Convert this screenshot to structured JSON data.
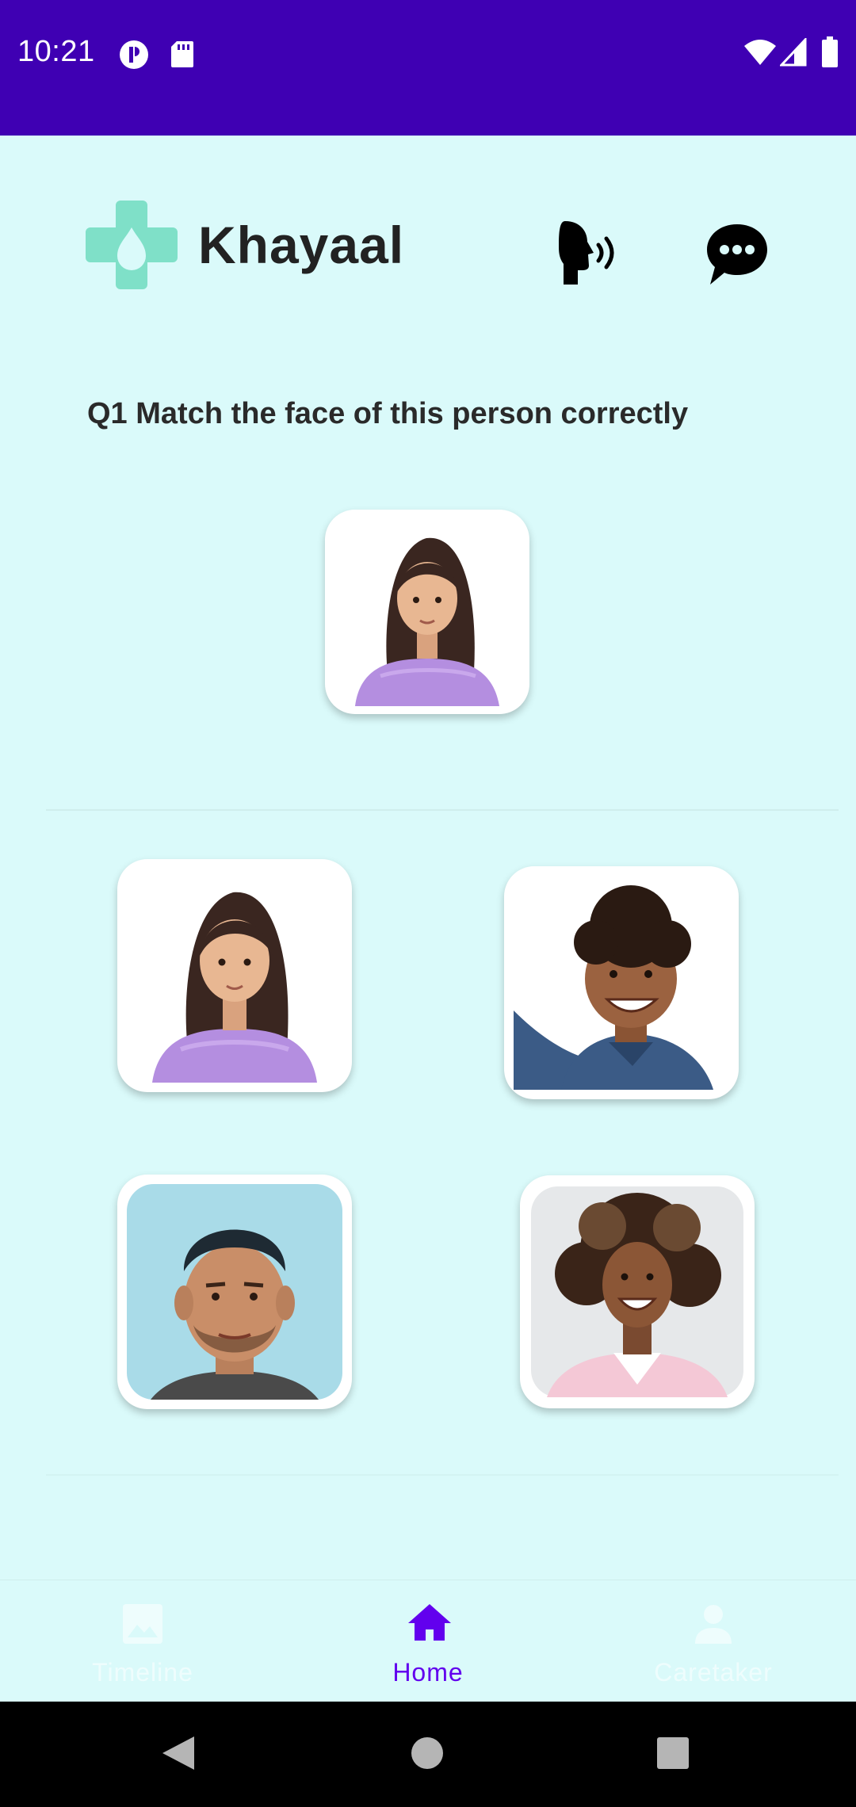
{
  "status_bar": {
    "time": "10:21",
    "left_icons": [
      "notification-app-icon",
      "sd-card-icon"
    ],
    "right_icons": [
      "wifi-icon",
      "signal-icon",
      "battery-icon"
    ],
    "background": "#3f00b3"
  },
  "header": {
    "app_name": "Khayaal",
    "logo_icon": "medical-cross-drop-logo",
    "speak_icon": "speaking-head-icon",
    "chat_icon": "chat-bubble-icon"
  },
  "question": {
    "text": "Q1  Match the face of this person correctly"
  },
  "target_photo": {
    "subject": "girl-curly-hair-lavender-shirt"
  },
  "options": [
    {
      "subject": "girl-curly-hair-lavender-shirt"
    },
    {
      "subject": "smiling-boy-denim-shirt"
    },
    {
      "subject": "man-backward-cap"
    },
    {
      "subject": "smiling-woman-curly-hair"
    }
  ],
  "bottom_nav": {
    "items": [
      {
        "label": "Timeline",
        "icon": "image-icon",
        "active": false
      },
      {
        "label": "Home",
        "icon": "home-icon",
        "active": true
      },
      {
        "label": "Caretaker",
        "icon": "person-icon",
        "active": false
      }
    ],
    "active_color": "#6200ee"
  },
  "system_nav": {
    "buttons": [
      "back-icon",
      "home-circle-icon",
      "recents-square-icon"
    ]
  },
  "colors": {
    "background": "#dafafa",
    "logo": "#7fe0c8",
    "card": "#ffffff"
  }
}
